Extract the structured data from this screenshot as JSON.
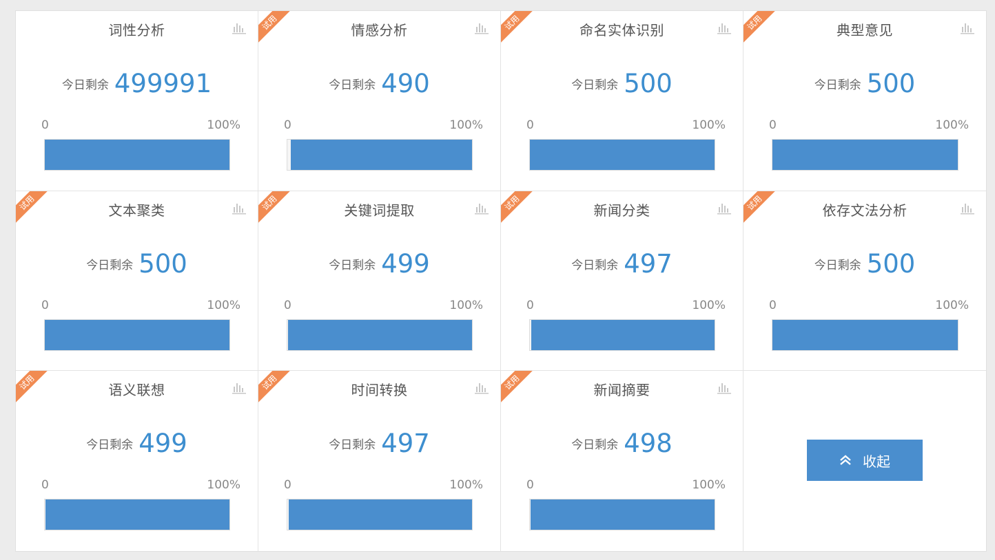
{
  "labels": {
    "remaining": "今日剩余",
    "scale_min": "0",
    "scale_max": "100%",
    "trial": "试用"
  },
  "colors": {
    "accent": "#4a8ece",
    "count": "#3d8ecf",
    "ribbon": "#f18b52"
  },
  "cards": [
    {
      "title": "词性分析",
      "remaining": "499991",
      "trial": false,
      "fill_percent": 100
    },
    {
      "title": "情感分析",
      "remaining": "490",
      "trial": true,
      "fill_percent": 98
    },
    {
      "title": "命名实体识别",
      "remaining": "500",
      "trial": true,
      "fill_percent": 100
    },
    {
      "title": "典型意见",
      "remaining": "500",
      "trial": true,
      "fill_percent": 100
    },
    {
      "title": "文本聚类",
      "remaining": "500",
      "trial": true,
      "fill_percent": 100
    },
    {
      "title": "关键词提取",
      "remaining": "499",
      "trial": true,
      "fill_percent": 99.8
    },
    {
      "title": "新闻分类",
      "remaining": "497",
      "trial": true,
      "fill_percent": 99.4
    },
    {
      "title": "依存文法分析",
      "remaining": "500",
      "trial": true,
      "fill_percent": 100
    },
    {
      "title": "语义联想",
      "remaining": "499",
      "trial": true,
      "fill_percent": 99.8
    },
    {
      "title": "时间转换",
      "remaining": "497",
      "trial": true,
      "fill_percent": 99.4
    },
    {
      "title": "新闻摘要",
      "remaining": "498",
      "trial": true,
      "fill_percent": 99.6
    }
  ],
  "collapse": {
    "label": "收起",
    "icon": "double-chevron-up-icon"
  }
}
